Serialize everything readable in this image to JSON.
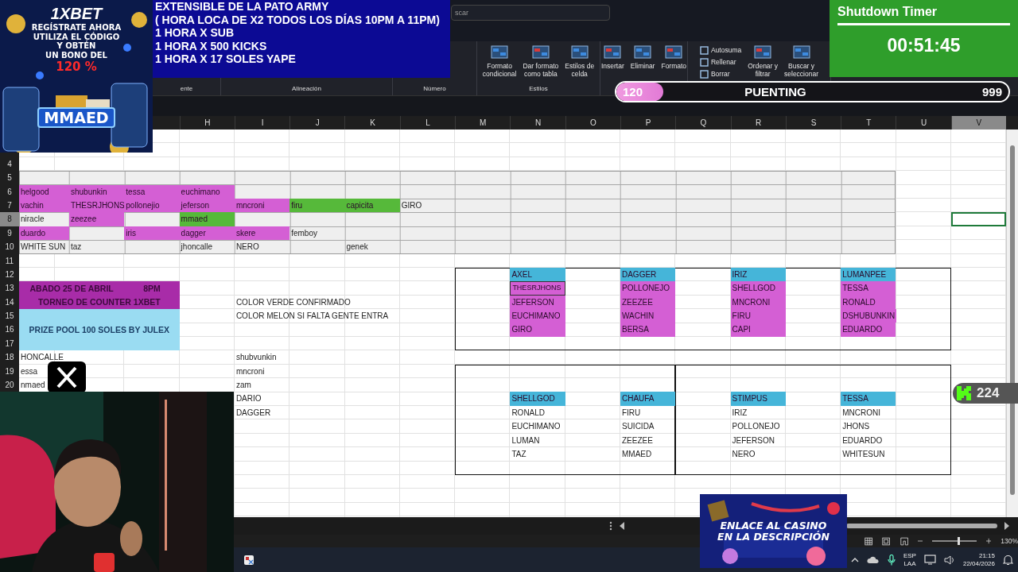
{
  "ad_banner": {
    "brand": "1XBET",
    "lines": [
      "REGÍSTRATE AHORA",
      "UTILIZA EL CÓDIGO",
      "Y OBTÉN",
      "UN BONO DEL"
    ],
    "bonus": "120 %",
    "code": "MMAED"
  },
  "info_box": {
    "lines": [
      "EXTENSIBLE  DE LA PATO ARMY",
      "( HORA LOCA DE X2 TODOS LOS DÍAS 10PM A 11PM)",
      "1 HORA X SUB",
      "1 HORA X 500 KICKS",
      "1 HORA X 17 SOLES YAPE"
    ]
  },
  "search": {
    "placeholder": "scar"
  },
  "ribbon_groups": [
    {
      "label": "ente"
    },
    {
      "label": "Alineación"
    },
    {
      "label": "Número"
    },
    {
      "label": "Estilos",
      "buttons": [
        {
          "kind": "large",
          "label": "Formato\ncondicional"
        },
        {
          "kind": "large",
          "label": "Dar formato\ncomo tabla"
        },
        {
          "kind": "large",
          "label": "Estilos de\ncelda"
        }
      ]
    },
    {
      "buttons": [
        {
          "kind": "large",
          "label": "Insertar"
        },
        {
          "kind": "large",
          "label": "Eliminar"
        },
        {
          "kind": "large",
          "label": "Formato"
        }
      ]
    },
    {
      "buttons": [
        {
          "kind": "small",
          "label": "Autosuma"
        },
        {
          "kind": "small",
          "label": "Rellenar"
        },
        {
          "kind": "small",
          "label": "Borrar"
        },
        {
          "kind": "large",
          "label": "Ordenar y\nfiltrar"
        },
        {
          "kind": "large",
          "label": "Buscar y\nseleccionar"
        }
      ]
    }
  ],
  "timer": {
    "title": "Shutdown Timer",
    "time": "00:51:45"
  },
  "goal_bar": {
    "current": "120",
    "title": "PUENTING",
    "target": "999",
    "level": 0.12
  },
  "column_headers": [
    {
      "label": "H",
      "selected": false
    },
    {
      "label": "I",
      "selected": false
    },
    {
      "label": "J",
      "selected": false
    },
    {
      "label": "K",
      "selected": false
    },
    {
      "label": "L",
      "selected": false
    },
    {
      "label": "M",
      "selected": false
    },
    {
      "label": "N",
      "selected": false
    },
    {
      "label": "O",
      "selected": false
    },
    {
      "label": "P",
      "selected": false
    },
    {
      "label": "Q",
      "selected": false
    },
    {
      "label": "R",
      "selected": false
    },
    {
      "label": "S",
      "selected": false
    },
    {
      "label": "T",
      "selected": false
    },
    {
      "label": "U",
      "selected": false
    },
    {
      "label": "V",
      "selected": true
    }
  ],
  "rows": [
    {
      "number": "4",
      "selected": false
    },
    {
      "number": "5",
      "selected": false
    },
    {
      "number": "6",
      "selected": false,
      "cells": [
        {
          "text": "helgood",
          "color": "#d45fd4"
        },
        {
          "text": "shubunkin",
          "color": "#d45fd4"
        },
        {
          "text": "tessa",
          "color": "#d45fd4"
        },
        {
          "text": "euchimano",
          "color": "#d45fd4"
        }
      ]
    },
    {
      "number": "7",
      "selected": false,
      "cells": [
        {
          "text": "vachin",
          "color": "#d45fd4"
        },
        {
          "text": "THESRJHONS",
          "color": "#d45fd4"
        },
        {
          "text": "pollonejio",
          "color": "#d45fd4"
        },
        {
          "text": "jeferson",
          "color": "#d45fd4"
        },
        {
          "text": "mncroni",
          "color": "#d45fd4"
        },
        {
          "text": "firu",
          "color": "#56b93a"
        },
        {
          "text": "capicita",
          "color": "#56b93a"
        },
        {
          "text": "GIRO"
        }
      ]
    },
    {
      "number": "8",
      "selected": true,
      "cells": [
        {
          "text": "niracle"
        },
        {
          "text": "zeezee",
          "color": "#d45fd4"
        },
        {},
        {
          "text": "mmaed",
          "color": "#56b93a"
        }
      ]
    },
    {
      "number": "9",
      "selected": false,
      "cells": [
        {
          "text": "duardo",
          "color": "#d45fd4"
        },
        {},
        {
          "text": "iris",
          "color": "#d45fd4"
        },
        {
          "text": "dagger",
          "color": "#d45fd4"
        },
        {
          "text": "skere",
          "color": "#d45fd4"
        },
        {
          "text": "femboy"
        }
      ]
    },
    {
      "number": "10",
      "selected": false,
      "cells": [
        {
          "text": "WHITE SUN"
        },
        {
          "text": "taz"
        },
        {},
        {
          "text": "jhoncalle"
        },
        {
          "text": "NERO"
        },
        {},
        {
          "text": "genek"
        }
      ]
    },
    {
      "number": "11",
      "selected": false
    },
    {
      "number": "12",
      "selected": false
    },
    {
      "number": "13",
      "selected": false
    },
    {
      "number": "14",
      "selected": false,
      "cells": [
        {},
        {},
        {},
        {},
        {
          "text": "COLOR VERDE CONFIRMADO"
        }
      ]
    },
    {
      "number": "15",
      "selected": false,
      "cells": [
        {},
        {},
        {},
        {},
        {
          "text": "COLOR MELON SI FALTA GENTE ENTRA"
        }
      ]
    },
    {
      "number": "16",
      "selected": false
    },
    {
      "number": "17",
      "selected": false
    },
    {
      "number": "18",
      "selected": false,
      "cells": [
        {
          "text": "HONCALLE"
        },
        {},
        {},
        {},
        {
          "text": "shubvunkin"
        }
      ]
    },
    {
      "number": "19",
      "selected": false,
      "cells": [
        {
          "text": "essa"
        },
        {},
        {},
        {},
        {
          "text": "mncroni"
        }
      ]
    },
    {
      "number": "20",
      "selected": false,
      "cells": [
        {
          "text": "nmaed"
        },
        {},
        {},
        {},
        {
          "text": "zam"
        }
      ]
    },
    {
      "cells": [
        {},
        {},
        {},
        {},
        {
          "text": "DARIO"
        }
      ]
    },
    {
      "cells": [
        {},
        {},
        {},
        {},
        {
          "text": "DAGGER"
        }
      ]
    }
  ],
  "event_card": {
    "date": "ABADO 25 DE ABRIL",
    "time": "8PM",
    "title": "TORNEO DE COUNTER  1XBET",
    "prize": "PRIZE POOL 100 SOLES BY JULEX"
  },
  "team_boxes": [
    {
      "teams": [
        {
          "captain": "AXEL",
          "color": "#45b5d9",
          "players": [
            {
              "name": "THESRJHONS",
              "color": "#d45fd4",
              "boxed": true
            },
            {
              "name": "JEFERSON",
              "color": "#d45fd4",
              "boxed": false
            },
            {
              "name": "EUCHIMANO",
              "color": "#d45fd4",
              "boxed": false
            },
            {
              "name": "GIRO",
              "color": "#d45fd4",
              "boxed": false
            }
          ]
        },
        {
          "captain": "DAGGER",
          "color": "#45b5d9",
          "players": [
            {
              "name": "POLLONEJO",
              "color": "#d45fd4",
              "boxed": false
            },
            {
              "name": "ZEEZEE",
              "color": "#d45fd4",
              "boxed": false
            },
            {
              "name": "WACHIN",
              "color": "#d45fd4",
              "boxed": false
            },
            {
              "name": "BERSA",
              "color": "#d45fd4",
              "boxed": false
            }
          ]
        },
        {
          "captain": "IRIZ",
          "color": "#45b5d9",
          "players": [
            {
              "name": "SHELLGOD",
              "color": "#d45fd4",
              "boxed": false
            },
            {
              "name": "MNCRONI",
              "color": "#d45fd4",
              "boxed": false
            },
            {
              "name": "FIRU",
              "color": "#d45fd4",
              "boxed": false
            },
            {
              "name": "CAPI",
              "color": "#d45fd4",
              "boxed": false
            }
          ]
        },
        {
          "captain": "LUMANPEE",
          "color": "#45b5d9",
          "players": [
            {
              "name": "TESSA",
              "color": "#d45fd4",
              "boxed": false
            },
            {
              "name": "RONALD",
              "color": "#d45fd4",
              "boxed": false
            },
            {
              "name": "DSHUBUNKIN",
              "color": "#d45fd4",
              "boxed": false
            },
            {
              "name": "EDUARDO",
              "color": "#d45fd4",
              "boxed": false
            }
          ]
        }
      ]
    },
    {
      "teams": [
        {
          "captain": "SHELLGOD",
          "color": "#45b5d9",
          "players": [
            {
              "name": "RONALD",
              "boxed": false
            },
            {
              "name": "EUCHIMANO",
              "boxed": false
            },
            {
              "name": "LUMAN",
              "boxed": false
            },
            {
              "name": "TAZ",
              "boxed": false
            }
          ]
        },
        {
          "captain": "CHAUFA",
          "color": "#45b5d9",
          "players": [
            {
              "name": "FIRU",
              "boxed": false
            },
            {
              "name": "SUICIDA",
              "boxed": false
            },
            {
              "name": "ZEEZEE",
              "boxed": false
            },
            {
              "name": "MMAED",
              "boxed": false
            }
          ]
        }
      ]
    },
    {
      "teams": [
        {
          "captain": "STIMPUS",
          "color": "#45b5d9",
          "players": [
            {
              "name": "IRIZ",
              "boxed": false
            },
            {
              "name": "POLLONEJO",
              "boxed": false
            },
            {
              "name": "JEFERSON",
              "boxed": false
            },
            {
              "name": "NERO",
              "boxed": false
            }
          ]
        },
        {
          "captain": "TESSA",
          "color": "#45b5d9",
          "players": [
            {
              "name": "MNCRONI",
              "boxed": false
            },
            {
              "name": "JHONS",
              "boxed": false
            },
            {
              "name": "EDUARDO",
              "boxed": false
            },
            {
              "name": "WHITESUN",
              "boxed": false
            }
          ]
        }
      ]
    }
  ],
  "kick_badge": {
    "count": "224"
  },
  "casino_ad": {
    "lines": [
      "ENLACE AL CASINO",
      "EN LA DESCRIPCIÓN"
    ]
  },
  "status_bar": {
    "zoom": {
      "level": 0.6,
      "reading": "130%"
    }
  },
  "taskbar": {
    "language": [
      "ESP",
      "LAA"
    ],
    "time": "21:15",
    "date": "22/04/2026"
  }
}
